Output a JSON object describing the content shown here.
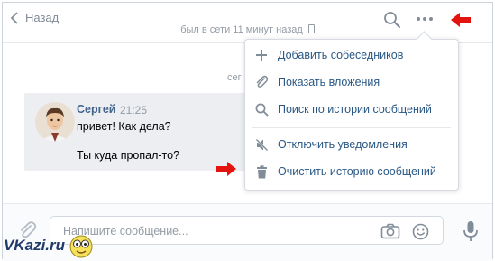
{
  "header": {
    "back_label": "Назад",
    "status_text": "был в сети 11 минут назад"
  },
  "chat": {
    "date_separator_partial": "сег",
    "message": {
      "author": "Сергей",
      "time": "21:25",
      "lines": [
        "привет! Как дела?",
        "Ты куда пропал-то?"
      ]
    }
  },
  "menu": {
    "items": [
      {
        "label": "Добавить собеседников",
        "icon": "plus-icon"
      },
      {
        "label": "Показать вложения",
        "icon": "paperclip-icon"
      },
      {
        "label": "Поиск по истории сообщений",
        "icon": "search-icon"
      },
      {
        "label": "Отключить уведомления",
        "icon": "mute-icon"
      },
      {
        "label": "Очистить историю сообщений",
        "icon": "trash-icon"
      }
    ]
  },
  "composer": {
    "placeholder": "Напишите сообщение..."
  },
  "watermark": {
    "text": "VKazi.ru"
  },
  "colors": {
    "link_blue": "#2a5885",
    "author_blue": "#42648b",
    "icon_gray": "#818c99",
    "message_bg": "#eceef2",
    "arrow_red": "#e3140f"
  }
}
